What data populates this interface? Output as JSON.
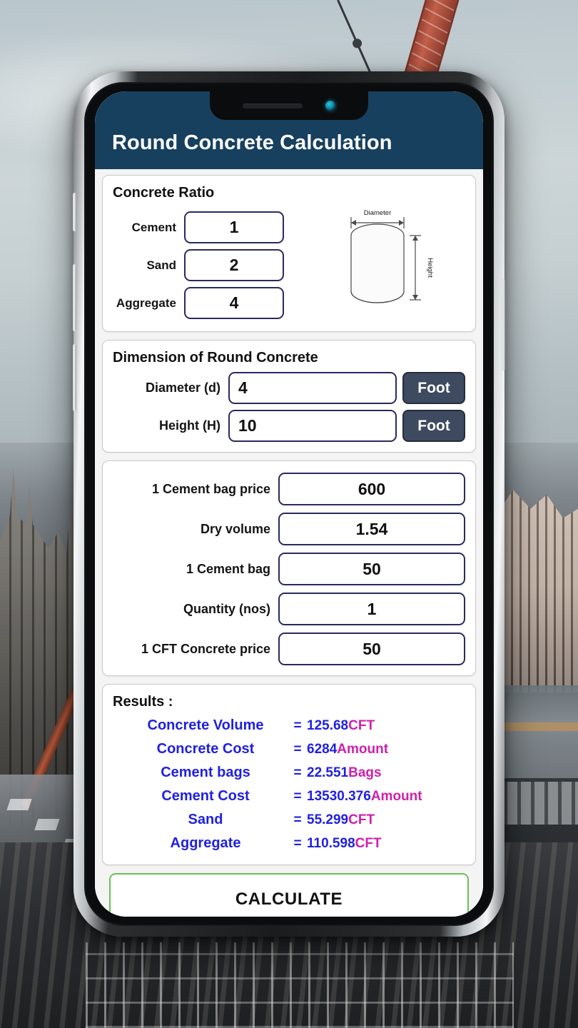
{
  "app": {
    "title": "Round Concrete Calculation",
    "header_color": "#17405f"
  },
  "ratio_card": {
    "title": "Concrete Ratio",
    "rows": [
      {
        "label": "Cement",
        "value": "1"
      },
      {
        "label": "Sand",
        "value": "2"
      },
      {
        "label": "Aggregate",
        "value": "4"
      }
    ],
    "figure": {
      "diameter_label": "Diameter",
      "height_label": "Height"
    }
  },
  "dimension_card": {
    "title": "Dimension of Round Concrete",
    "rows": [
      {
        "label": "Diameter (d)",
        "value": "4",
        "unit": "Foot"
      },
      {
        "label": "Height (H)",
        "value": "10",
        "unit": "Foot"
      }
    ],
    "unit_button_color": "#3e4a60"
  },
  "price_card": {
    "rows": [
      {
        "label": "1 Cement bag price",
        "value": "600"
      },
      {
        "label": "Dry volume",
        "value": "1.54"
      },
      {
        "label": "1 Cement bag",
        "value": "50"
      },
      {
        "label": "Quantity (nos)",
        "value": "1"
      },
      {
        "label": "1 CFT Concrete price",
        "value": "50"
      }
    ]
  },
  "results_card": {
    "title": "Results  :",
    "label_color": "#2020e0",
    "unit_color": "#cf1fab",
    "rows": [
      {
        "label": "Concrete Volume",
        "eq": "=",
        "value": "125.68",
        "unit": "CFT"
      },
      {
        "label": "Concrete Cost",
        "eq": "=",
        "value": "6284",
        "unit": "Amount"
      },
      {
        "label": "Cement bags",
        "eq": "=",
        "value": "22.551",
        "unit": "Bags"
      },
      {
        "label": "Cement Cost",
        "eq": "=",
        "value": "13530.376",
        "unit": "Amount"
      },
      {
        "label": "Sand",
        "eq": "=",
        "value": "55.299",
        "unit": "CFT"
      },
      {
        "label": "Aggregate",
        "eq": "=",
        "value": "110.598",
        "unit": "CFT"
      }
    ]
  },
  "calculate_button": {
    "label": "CALCULATE",
    "border_color": "#6abf59"
  }
}
